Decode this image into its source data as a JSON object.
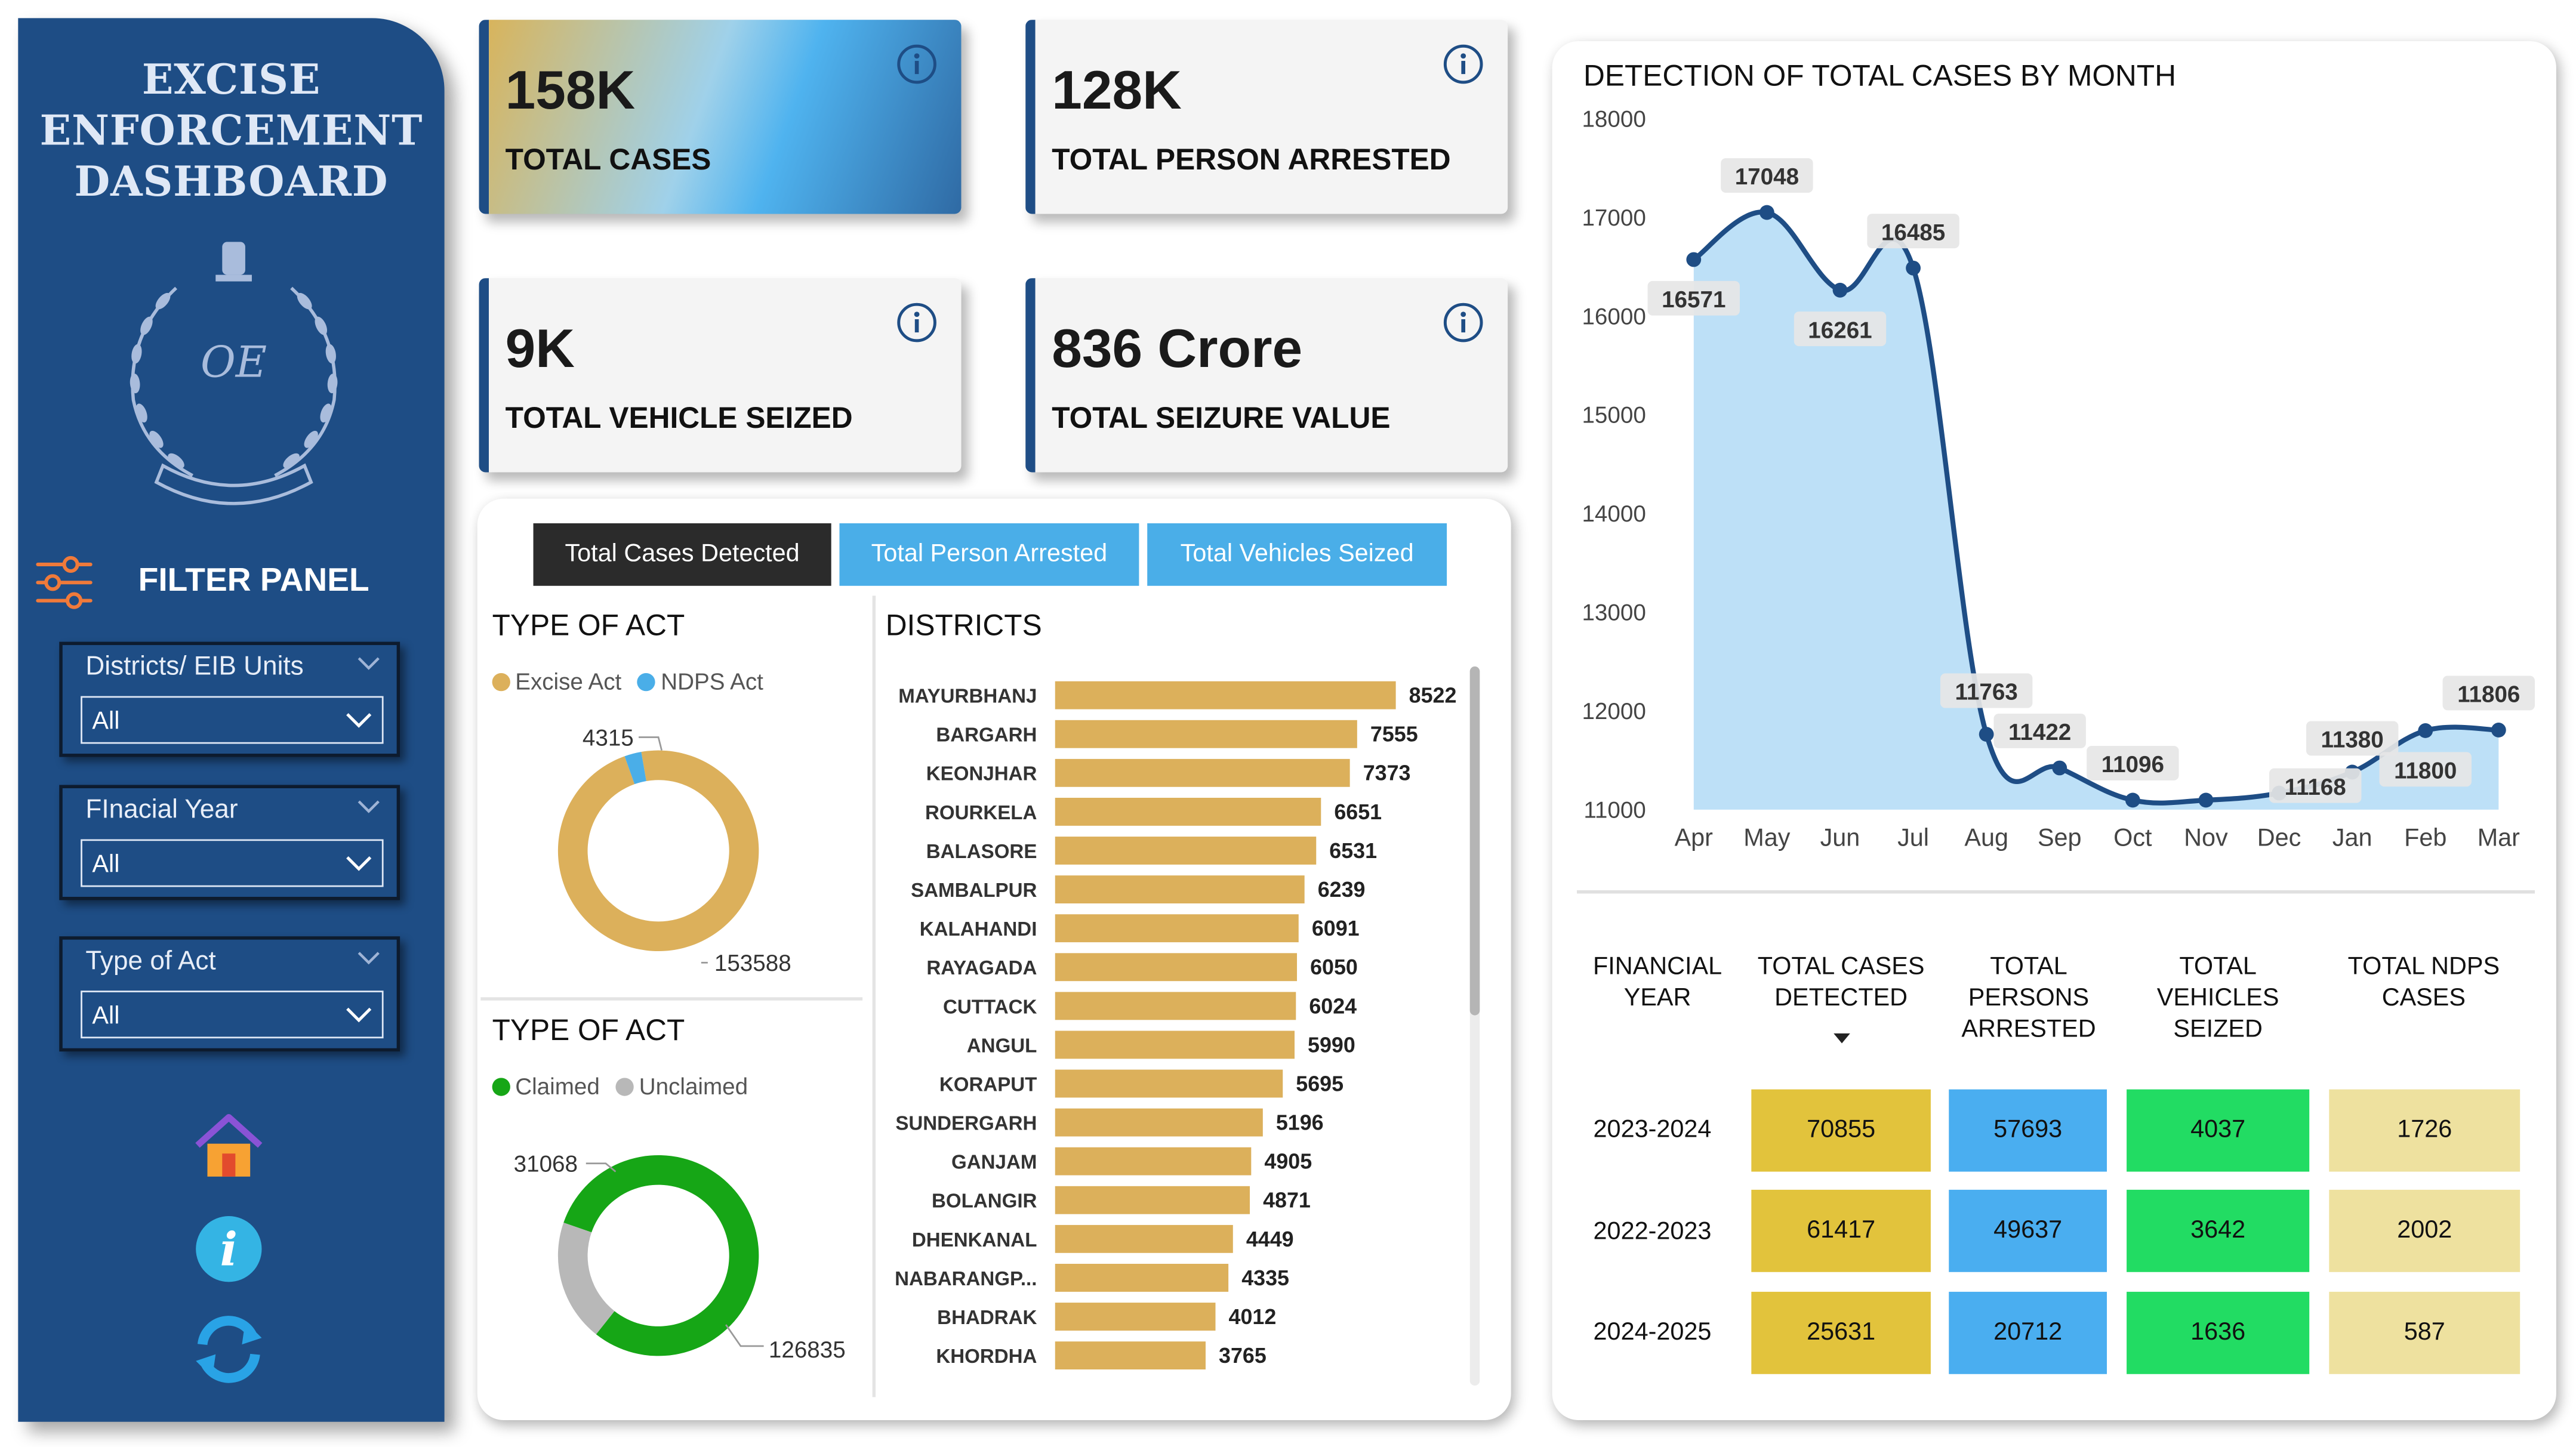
{
  "sidebar": {
    "title_lines": [
      "EXCISE",
      "ENFORCEMENT",
      "DASHBOARD"
    ],
    "filter_panel_label": "FILTER PANEL",
    "slicers": [
      {
        "label": "Districts/ EIB Units",
        "value": "All"
      },
      {
        "label": "FInacial Year",
        "value": "All"
      },
      {
        "label": "Type of Act",
        "value": "All"
      }
    ],
    "icons": [
      "home-icon",
      "info-icon",
      "refresh-icon"
    ]
  },
  "kpis": [
    {
      "value": "158K",
      "caption": "TOTAL CASES"
    },
    {
      "value": "128K",
      "caption": "TOTAL PERSON ARRESTED"
    },
    {
      "value": "9K",
      "caption": "TOTAL VEHICLE SEIZED"
    },
    {
      "value": "836 Crore",
      "caption": "TOTAL SEIZURE VALUE"
    }
  ],
  "tabs": [
    {
      "label": "Total Cases Detected",
      "active": true
    },
    {
      "label": "Total Person Arrested",
      "active": false
    },
    {
      "label": "Total Vehicles Seized",
      "active": false
    }
  ],
  "colors": {
    "sidebar": "#1e4d85",
    "excise": "#dcb05b",
    "ndps": "#4aaee8",
    "claimed": "#16a616",
    "unclaimed": "#b8b8b8",
    "bar": "#dcb05b",
    "line": "#1e4d85",
    "area": "#bde0f7",
    "tab_active": "#2b2b2b",
    "tab_inactive": "#4aaee8"
  },
  "chart_data": [
    {
      "type": "pie",
      "title": "TYPE OF ACT",
      "donut": true,
      "legend": [
        "Excise Act",
        "NDPS Act"
      ],
      "labels": [
        "Excise Act",
        "NDPS Act"
      ],
      "values": [
        153588,
        4315
      ],
      "value_labels": [
        "153588",
        "4315"
      ]
    },
    {
      "type": "pie",
      "title": "TYPE OF ACT",
      "donut": true,
      "legend": [
        "Claimed",
        "Unclaimed"
      ],
      "labels": [
        "Claimed",
        "Unclaimed"
      ],
      "values": [
        126835,
        31068
      ],
      "value_labels": [
        "126835",
        "31068"
      ]
    },
    {
      "type": "bar",
      "orientation": "horizontal",
      "title": "DISTRICTS",
      "categories": [
        "MAYURBHANJ",
        "BARGARH",
        "KEONJHAR",
        "ROURKELA",
        "BALASORE",
        "SAMBALPUR",
        "KALAHANDI",
        "RAYAGADA",
        "CUTTACK",
        "ANGUL",
        "KORAPUT",
        "SUNDERGARH",
        "GANJAM",
        "BOLANGIR",
        "DHENKANAL",
        "NABARANGP...",
        "BHADRAK",
        "KHORDHA"
      ],
      "values": [
        8522,
        7555,
        7373,
        6651,
        6531,
        6239,
        6091,
        6050,
        6024,
        5990,
        5695,
        5196,
        4905,
        4871,
        4449,
        4335,
        4012,
        3765
      ],
      "xlim": [
        0,
        8522
      ]
    },
    {
      "type": "area",
      "title": "DETECTION OF TOTAL CASES BY MONTH",
      "categories": [
        "Apr",
        "May",
        "Jun",
        "Jul",
        "Aug",
        "Sep",
        "Oct",
        "Nov",
        "Dec",
        "Jan",
        "Feb",
        "Mar"
      ],
      "values": [
        16571,
        17048,
        16261,
        16485,
        11763,
        11422,
        11096,
        11096,
        11168,
        11380,
        11800,
        11806
      ],
      "data_labels": [
        "16571",
        "17048",
        "16261",
        "16485",
        "11763",
        "11422",
        "11096",
        "",
        "11168",
        "11380",
        "11800",
        "11806"
      ],
      "ylim": [
        11000,
        18000
      ],
      "yticks": [
        11000,
        12000,
        13000,
        14000,
        15000,
        16000,
        17000,
        18000
      ],
      "grid": false
    }
  ],
  "table": {
    "headers": [
      [
        "FINANCIAL",
        "YEAR"
      ],
      [
        "TOTAL CASES",
        "DETECTED"
      ],
      [
        "TOTAL",
        "PERSONS",
        "ARRESTED"
      ],
      [
        "TOTAL",
        "VEHICLES",
        "SEIZED"
      ],
      [
        "TOTAL NDPS",
        "CASES"
      ]
    ],
    "rows": [
      {
        "year": "2023-2024",
        "cells": [
          "70855",
          "57693",
          "4037",
          "1726"
        ]
      },
      {
        "year": "2022-2023",
        "cells": [
          "61417",
          "49637",
          "3642",
          "2002"
        ]
      },
      {
        "year": "2024-2025",
        "cells": [
          "25631",
          "20712",
          "1636",
          "587"
        ]
      }
    ],
    "column_colors": [
      "#e2c33c",
      "#4aaef0",
      "#22dc63",
      "#eee19f"
    ]
  }
}
